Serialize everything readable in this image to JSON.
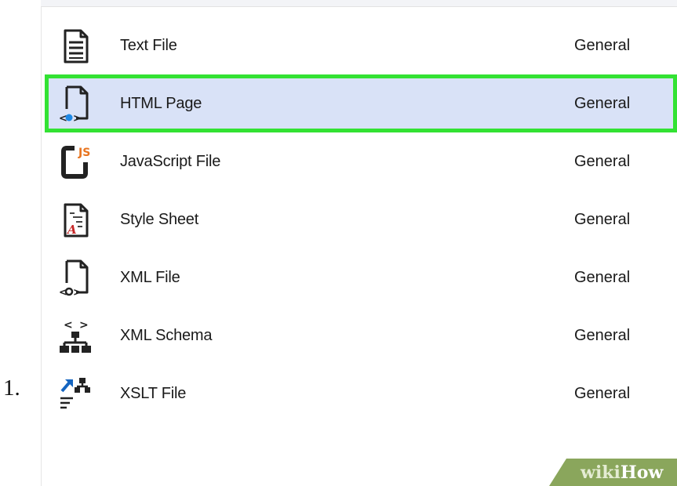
{
  "step_number": "1.",
  "items": [
    {
      "name": "Text File",
      "category": "General",
      "icon": "text-file-icon"
    },
    {
      "name": "HTML Page",
      "category": "General",
      "icon": "html-page-icon",
      "selected": true
    },
    {
      "name": "JavaScript File",
      "category": "General",
      "icon": "javascript-file-icon",
      "icon_badge": "JS"
    },
    {
      "name": "Style Sheet",
      "category": "General",
      "icon": "style-sheet-icon"
    },
    {
      "name": "XML File",
      "category": "General",
      "icon": "xml-file-icon"
    },
    {
      "name": "XML Schema",
      "category": "General",
      "icon": "xml-schema-icon"
    },
    {
      "name": "XSLT File",
      "category": "General",
      "icon": "xslt-file-icon"
    }
  ],
  "colors": {
    "selection_background": "#d9e2f7",
    "highlight_outline": "#33e233",
    "js_badge": "#e8741e",
    "html_accent": "#1e88e5",
    "xslt_arrow": "#1565c0",
    "watermark": "#8aa65c"
  },
  "watermark": {
    "prefix": "wiki",
    "suffix": "How"
  }
}
